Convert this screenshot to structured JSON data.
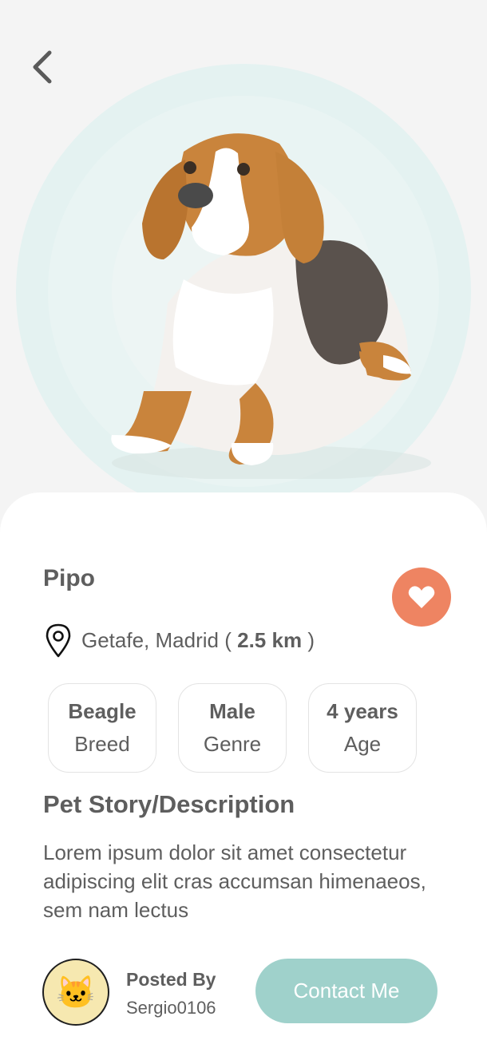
{
  "pet": {
    "name": "Pipo",
    "location": {
      "city": "Getafe, Madrid",
      "open": "(",
      "distance": "2.5 km",
      "close": ")"
    },
    "stats": [
      {
        "value": "Beagle",
        "label": "Breed"
      },
      {
        "value": "Male",
        "label": "Genre"
      },
      {
        "value": "4 years",
        "label": "Age"
      }
    ]
  },
  "story": {
    "title": "Pet Story/Description",
    "text": "Lorem ipsum dolor sit amet consectetur adipiscing elit cras accumsan himenaeos, sem nam lectus"
  },
  "poster": {
    "label": "Posted By",
    "username": "Sergio0106",
    "avatar_glyph": "🐱"
  },
  "actions": {
    "contact_label": "Contact Me"
  },
  "icons": {
    "back": "chevron-left-icon",
    "favorite": "heart-icon",
    "location": "location-pin-icon"
  },
  "colors": {
    "favorite_bg": "#ee8462",
    "contact_bg": "#9fd1cb",
    "hero_ring": "#e4f2f1",
    "avatar_bg": "#f6e8b0"
  }
}
